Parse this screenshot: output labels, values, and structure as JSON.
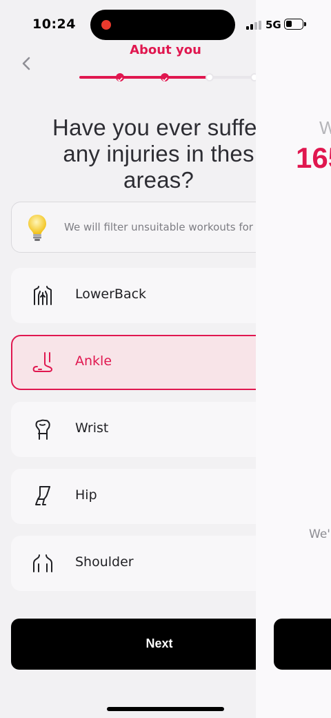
{
  "status_bar": {
    "time": "10:24",
    "network": "5G",
    "recording_color": "#ea3a2d"
  },
  "header": {
    "title": "About you",
    "back_icon": "chevron-left-icon",
    "progress": {
      "total_steps": 5,
      "completed_steps": 2,
      "current_step": 3
    }
  },
  "question": {
    "lines": [
      "Have you ever suffer",
      "any injuries in thes",
      "areas?"
    ]
  },
  "info": {
    "icon": "lightbulb-icon",
    "text": "We will filter unsuitable workouts for"
  },
  "options": [
    {
      "label": "LowerBack",
      "icon": "lower-back-icon",
      "selected": false
    },
    {
      "label": "Ankle",
      "icon": "ankle-icon",
      "selected": true
    },
    {
      "label": "Wrist",
      "icon": "wrist-icon",
      "selected": false
    },
    {
      "label": "Hip",
      "icon": "hip-icon",
      "selected": false
    },
    {
      "label": "Shoulder",
      "icon": "shoulder-icon",
      "selected": false
    }
  ],
  "next_button": {
    "label": "Next"
  },
  "background_screen": {
    "partial_heading": "W",
    "partial_value": "165",
    "partial_text": "We'",
    "button_label": ""
  },
  "colors": {
    "accent": "#e0174f",
    "selected_bg": "#f8e4e8",
    "progress_inactive": "#e8e6ea",
    "background": "#f2f1f3"
  }
}
